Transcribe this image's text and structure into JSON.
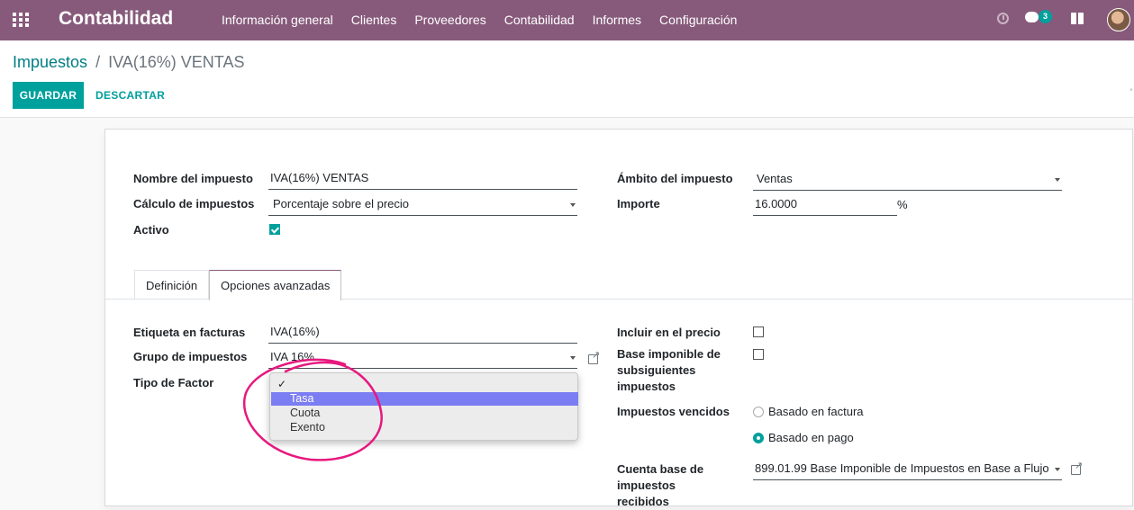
{
  "app": {
    "title": "Contabilidad",
    "menu": [
      "Información general",
      "Clientes",
      "Proveedores",
      "Contabilidad",
      "Informes",
      "Configuración"
    ],
    "chat_count": "3",
    "icons": [
      "apps-grid-icon",
      "clock-icon",
      "chat-icon",
      "gift-icon",
      "avatar"
    ],
    "accent": "#875a7b"
  },
  "breadcrumb": {
    "parent": "Impuestos",
    "separator": "/",
    "current": "IVA(16%) VENTAS"
  },
  "actions": {
    "save": "GUARDAR",
    "discard": "DESCARTAR",
    "save_color": "#00a09d"
  },
  "form": {
    "name_label": "Nombre del impuesto",
    "name_value": "IVA(16%) VENTAS",
    "calc_label": "Cálculo de impuestos",
    "calc_value": "Porcentaje sobre el precio",
    "active_label": "Activo",
    "active_checked": true,
    "scope_label": "Ámbito del impuesto",
    "scope_value": "Ventas",
    "amount_label": "Importe",
    "amount_value": "16.0000",
    "amount_unit": "%"
  },
  "tabs": [
    {
      "label": "Definición",
      "active": false
    },
    {
      "label": "Opciones avanzadas",
      "active": true
    }
  ],
  "advanced": {
    "invoice_label": "Etiqueta en facturas",
    "invoice_value": "IVA(16%)",
    "group_label": "Grupo de impuestos",
    "group_value": "IVA 16%",
    "factor_label": "Tipo de Factor",
    "factor_options": [
      "",
      "Tasa",
      "Cuota",
      "Exento"
    ],
    "factor_checked_index": 0,
    "factor_highlight_index": 1,
    "check_mark": "✓",
    "include_label": "Incluir en el precio",
    "base_label": "Base imponible de subsiguientes impuestos",
    "exigibility_label": "Impuestos vencidos",
    "exigibility_options": [
      "Basado en factura",
      "Basado en pago"
    ],
    "exigibility_selected": "Basado en pago",
    "cash_basis_label": "Cuenta base de impuestos recibidos",
    "cash_basis_value": "899.01.99 Base Imponible de Impuestos en Base a Flujo"
  },
  "annotation": {
    "circle_color": "#e6197f"
  }
}
